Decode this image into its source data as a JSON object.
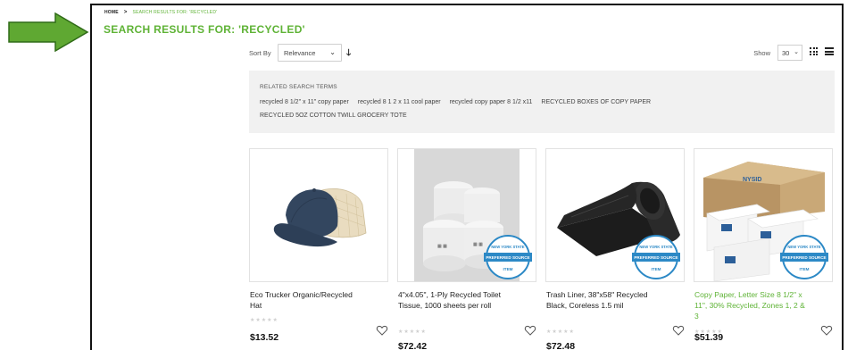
{
  "breadcrumb": {
    "home": "HOME",
    "separator": ">",
    "current": "SEARCH RESULTS FOR: 'RECYCLED'"
  },
  "page_title": "SEARCH RESULTS FOR: 'RECYCLED'",
  "toolbar": {
    "sort_label": "Sort By",
    "sort_value": "Relevance",
    "sort_direction_icon": "arrow-down-icon",
    "show_label": "Show",
    "show_value": "30",
    "view_modes": [
      "grid-icon",
      "list-icon"
    ]
  },
  "related": {
    "heading": "RELATED SEARCH TERMS",
    "terms": [
      "recycled 8 1/2\" x 11\" copy paper",
      "recycled 8 1 2 x 11 cool paper",
      "recycled copy paper 8 1/2 x11",
      "RECYCLED BOXES OF COPY PAPER",
      "RECYCLED 5OZ COTTON TWILL GROCERY TOTE"
    ]
  },
  "products": [
    {
      "name": "Eco Trucker Organic/Recycled Hat",
      "price": "$13.52",
      "rating_stars": "★★★★★",
      "rating": 0,
      "image": "hat",
      "badge": false,
      "highlight": false
    },
    {
      "name": "4\"x4.05\", 1-Ply Recycled Toilet Tissue, 1000 sheets per roll",
      "price": "$72.42",
      "rating_stars": "★★★★★",
      "rating": 0,
      "image": "tissue",
      "badge": true,
      "highlight": false
    },
    {
      "name": "Trash Liner, 38\"x58\" Recycled Black, Coreless 1.5 mil",
      "price": "$72.48",
      "rating_stars": "★★★★★",
      "rating": 0,
      "image": "trash-liner",
      "badge": true,
      "highlight": false
    },
    {
      "name": "Copy Paper, Letter Size 8 1/2\" x 11\", 30% Recycled, Zones 1, 2 & 3",
      "price": "$51.39",
      "rating_stars": "★★★★★",
      "rating": 0,
      "image": "copy-paper",
      "badge": true,
      "highlight": true
    }
  ],
  "badge_text": {
    "top": "NEW YORK STATE",
    "middle": "PREFERRED SOURCE",
    "bottom": "ITEM"
  },
  "box_text": "NYSID",
  "colors": {
    "accent_green": "#5fb336",
    "arrow_green": "#5fa832",
    "badge_blue": "#2c89c6"
  }
}
